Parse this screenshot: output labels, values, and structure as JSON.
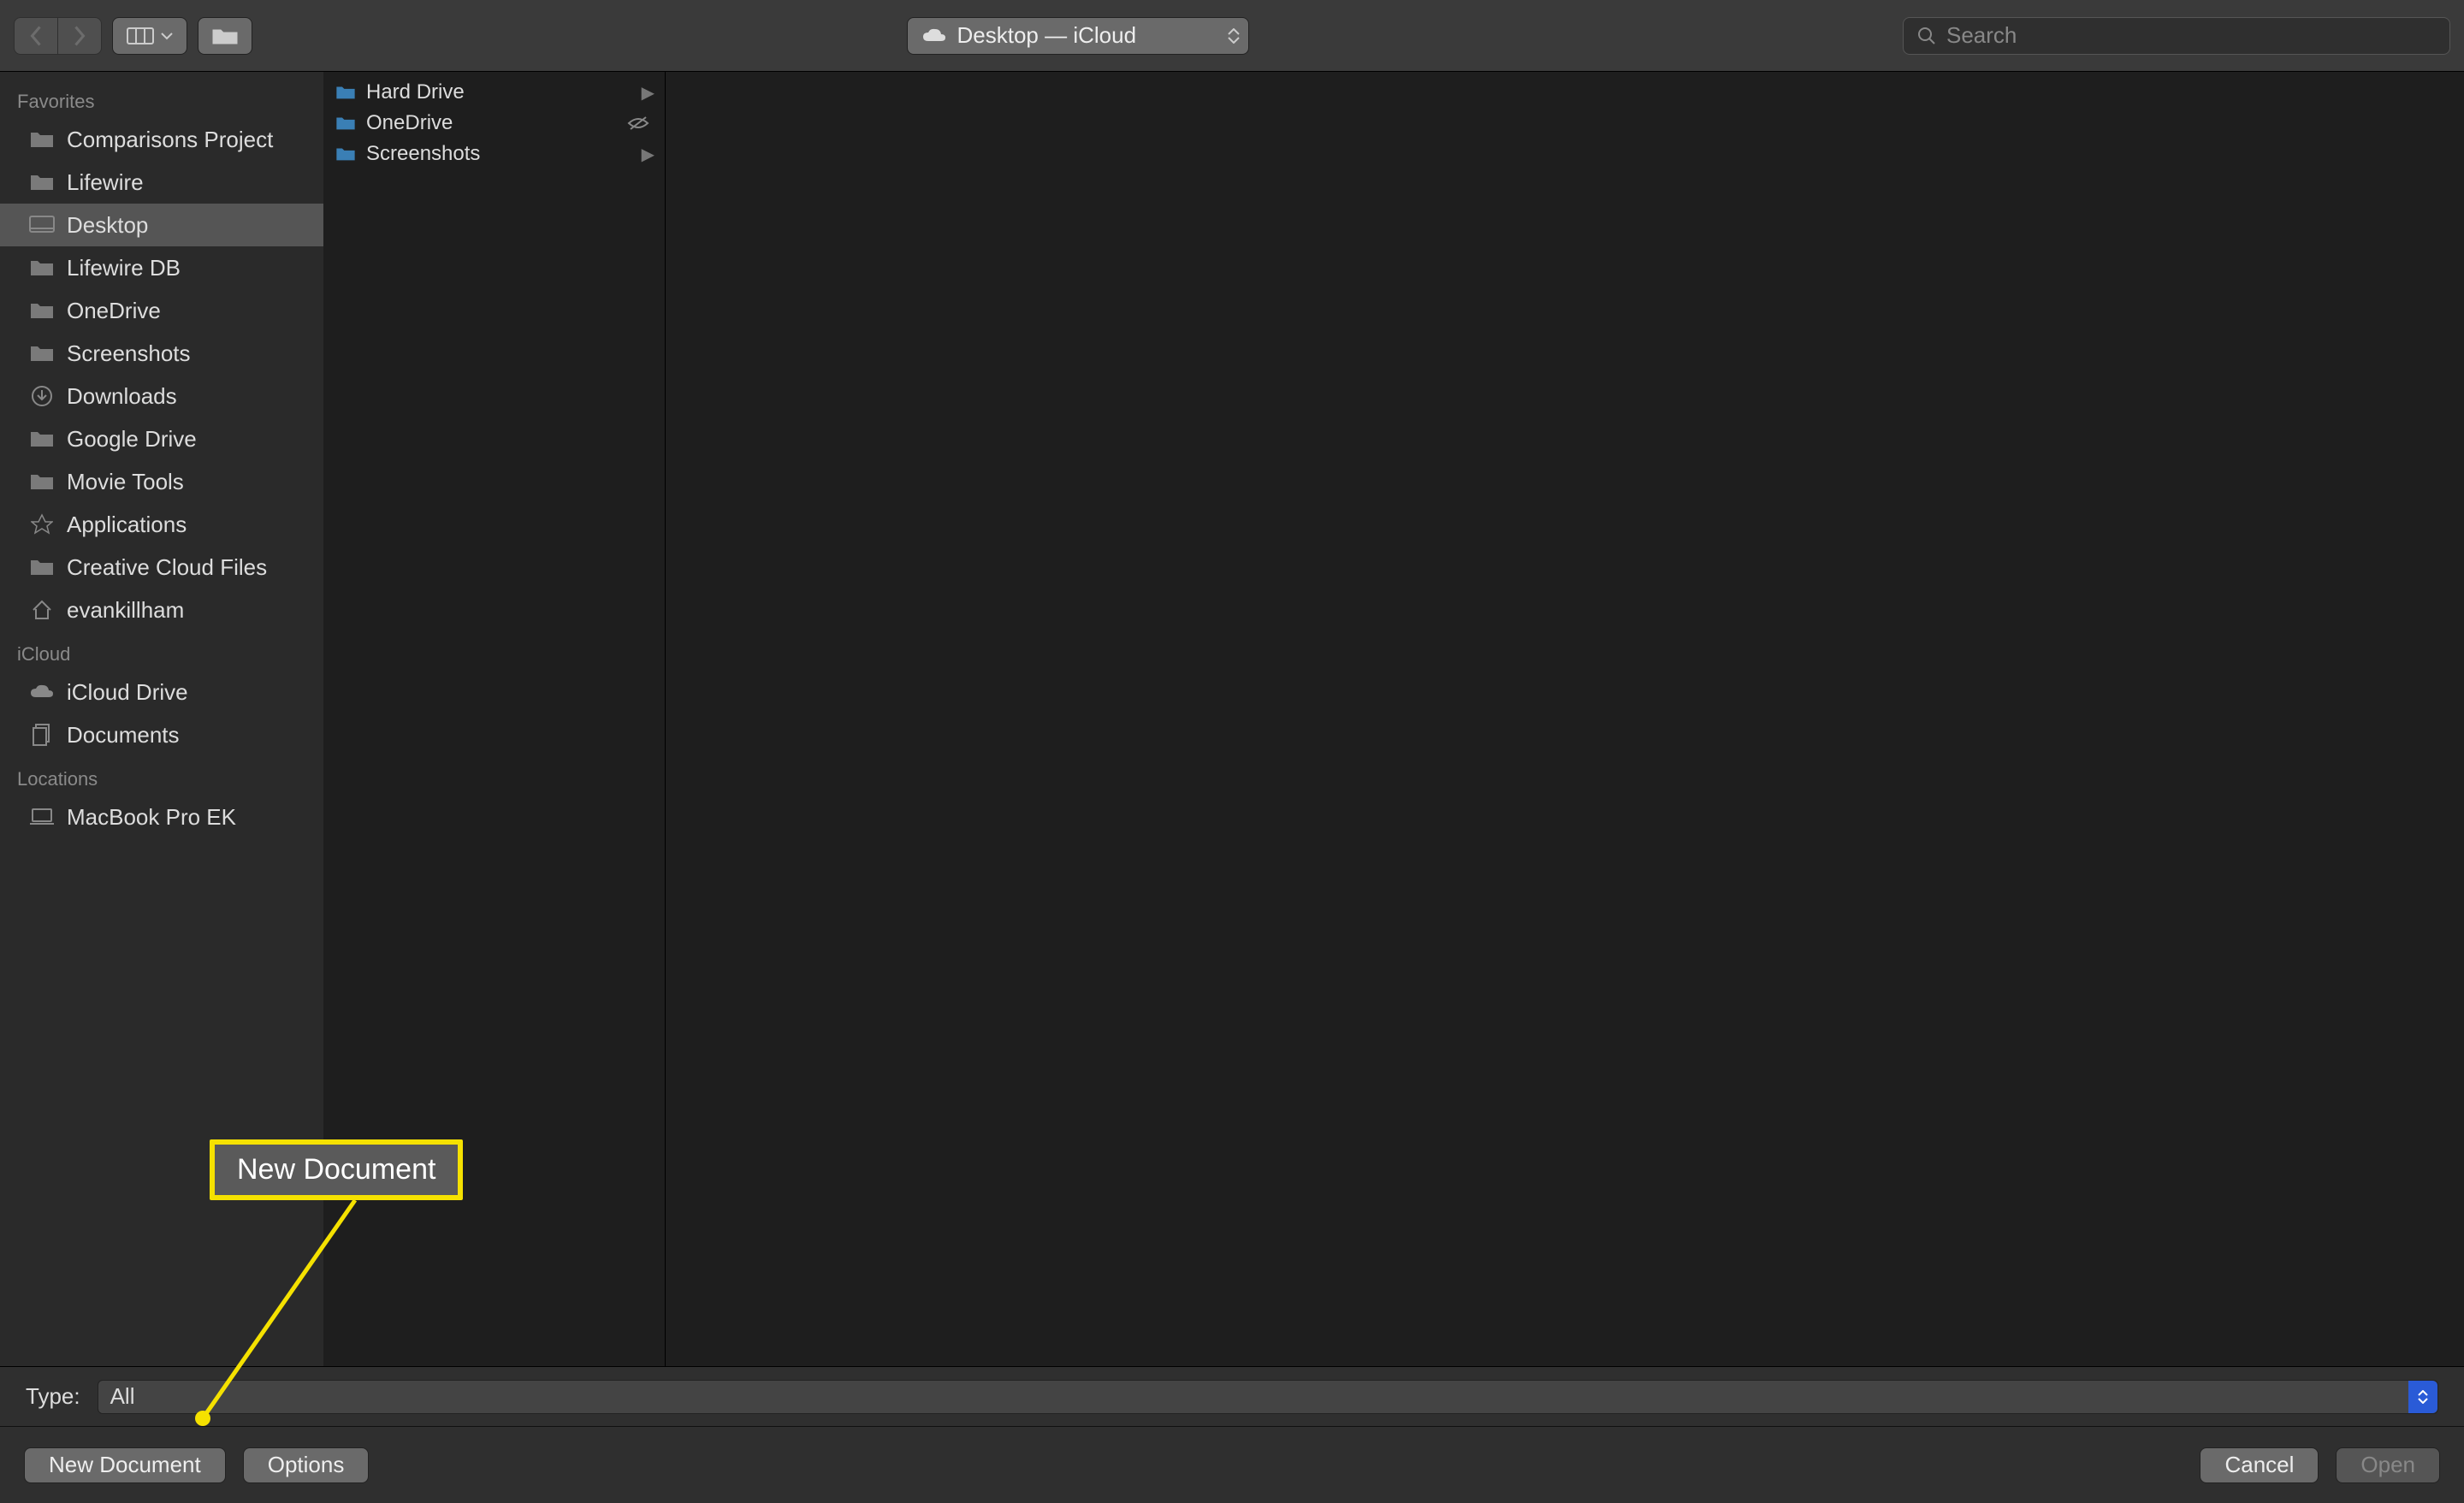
{
  "toolbar": {
    "location": "Desktop — iCloud",
    "search_placeholder": "Search"
  },
  "sidebar": {
    "sections": [
      {
        "header": "Favorites",
        "items": [
          {
            "icon": "folder",
            "label": "Comparisons Project",
            "selected": false
          },
          {
            "icon": "folder",
            "label": "Lifewire",
            "selected": false
          },
          {
            "icon": "desktop",
            "label": "Desktop",
            "selected": true
          },
          {
            "icon": "folder",
            "label": "Lifewire DB",
            "selected": false
          },
          {
            "icon": "folder",
            "label": "OneDrive",
            "selected": false
          },
          {
            "icon": "folder",
            "label": "Screenshots",
            "selected": false
          },
          {
            "icon": "downloads",
            "label": "Downloads",
            "selected": false
          },
          {
            "icon": "folder",
            "label": "Google Drive",
            "selected": false
          },
          {
            "icon": "folder",
            "label": "Movie Tools",
            "selected": false
          },
          {
            "icon": "applications",
            "label": "Applications",
            "selected": false
          },
          {
            "icon": "folder",
            "label": "Creative Cloud Files",
            "selected": false
          },
          {
            "icon": "home",
            "label": "evankillham",
            "selected": false
          }
        ]
      },
      {
        "header": "iCloud",
        "items": [
          {
            "icon": "cloud",
            "label": "iCloud Drive",
            "selected": false
          },
          {
            "icon": "documents",
            "label": "Documents",
            "selected": false
          }
        ]
      },
      {
        "header": "Locations",
        "items": [
          {
            "icon": "laptop",
            "label": "MacBook Pro EK",
            "selected": false
          }
        ]
      }
    ]
  },
  "columns": [
    {
      "items": [
        {
          "icon": "folder",
          "label": "Hard Drive",
          "has_children": true,
          "hidden_badge": false
        },
        {
          "icon": "folder",
          "label": "OneDrive",
          "has_children": false,
          "hidden_badge": true
        },
        {
          "icon": "folder",
          "label": "Screenshots",
          "has_children": true,
          "hidden_badge": false
        }
      ]
    }
  ],
  "type_bar": {
    "label": "Type:",
    "value": "All"
  },
  "buttons": {
    "new_document": "New Document",
    "options": "Options",
    "cancel": "Cancel",
    "open": "Open"
  },
  "callout": {
    "text": "New Document"
  }
}
